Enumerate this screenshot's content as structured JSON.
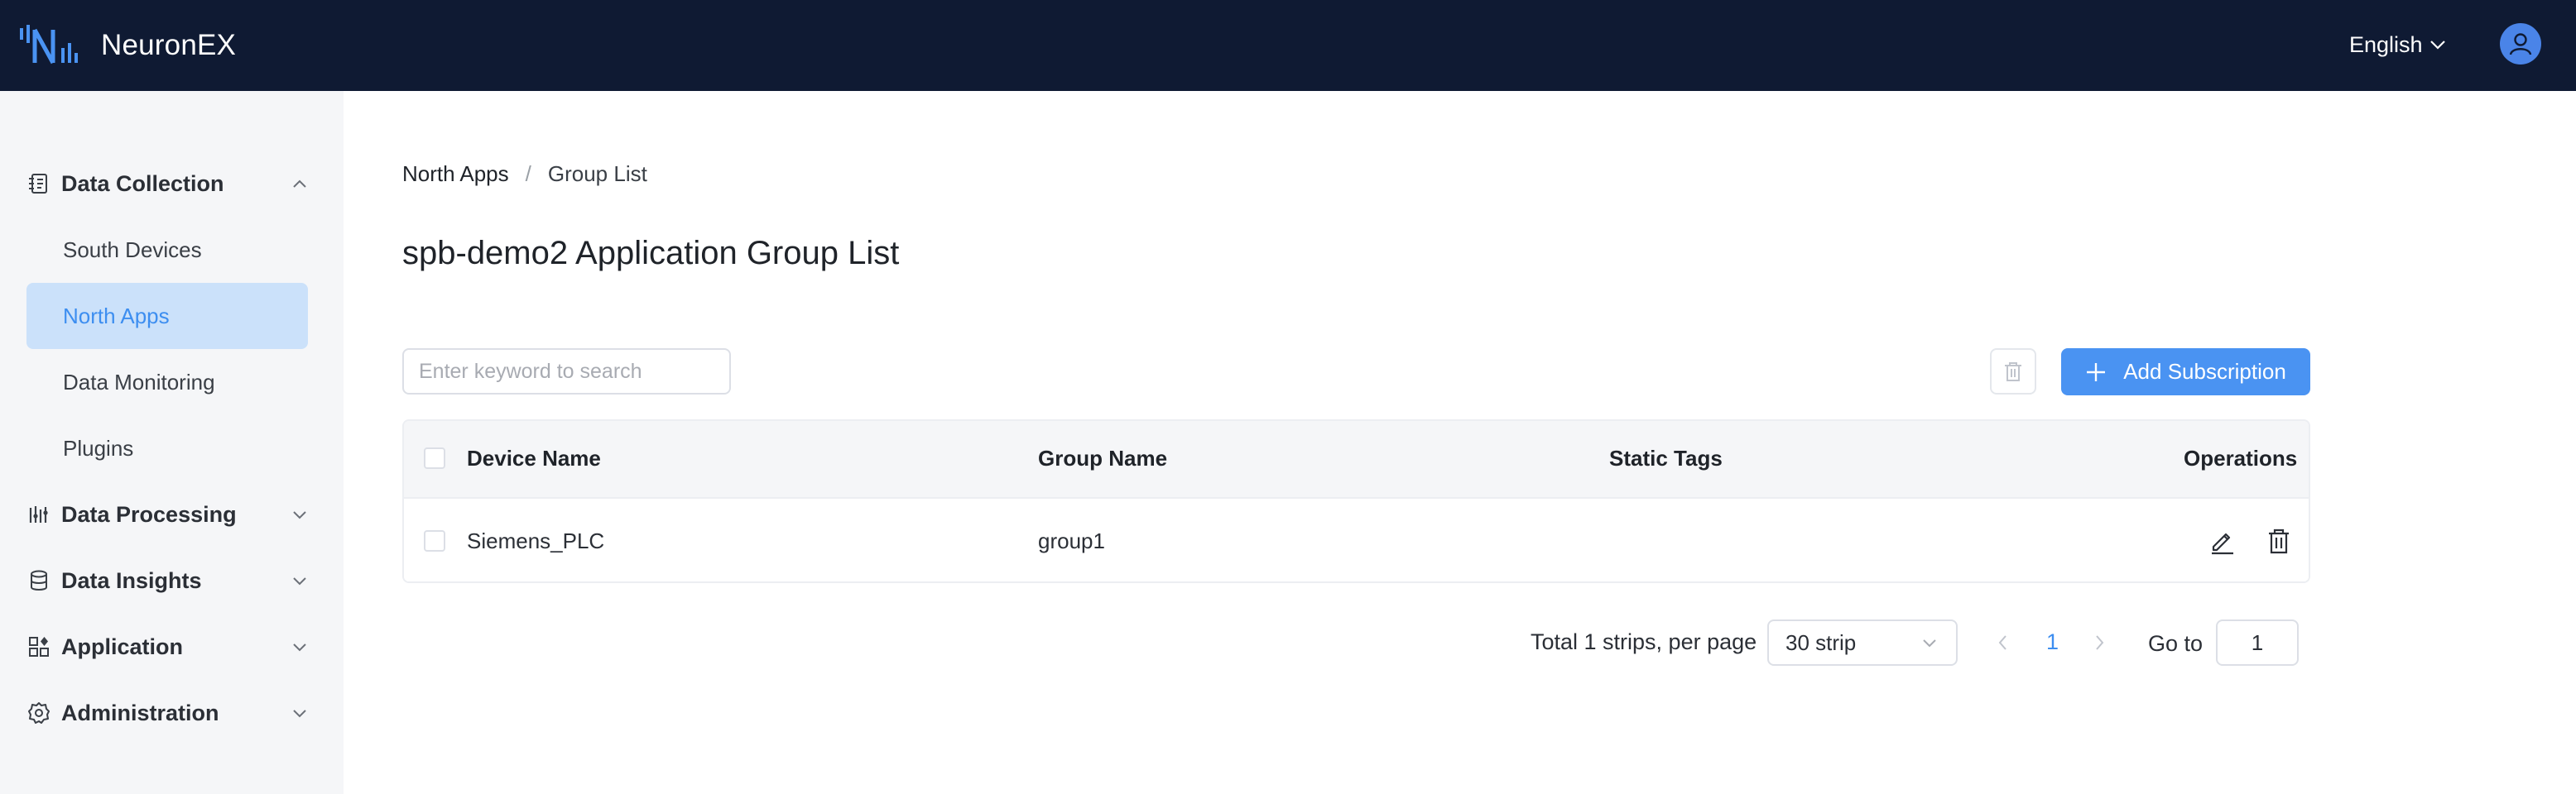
{
  "app": {
    "name": "NeuronEX"
  },
  "header": {
    "language": "English",
    "avatar_icon": "user-icon"
  },
  "sidebar": {
    "groups": [
      {
        "label": "Data Collection",
        "icon": "data-collection-icon",
        "expanded": true,
        "items": [
          {
            "label": "South Devices",
            "active": false
          },
          {
            "label": "North Apps",
            "active": true
          },
          {
            "label": "Data Monitoring",
            "active": false
          },
          {
            "label": "Plugins",
            "active": false
          }
        ]
      },
      {
        "label": "Data Processing",
        "icon": "data-processing-icon",
        "expanded": false
      },
      {
        "label": "Data Insights",
        "icon": "database-icon",
        "expanded": false
      },
      {
        "label": "Application",
        "icon": "application-icon",
        "expanded": false
      },
      {
        "label": "Administration",
        "icon": "gear-icon",
        "expanded": false
      }
    ]
  },
  "breadcrumb": {
    "parent": "North Apps",
    "separator": "/",
    "current": "Group List"
  },
  "page": {
    "title": "spb-demo2 Application Group List"
  },
  "toolbar": {
    "search_placeholder": "Enter keyword to search",
    "add_label": "Add Subscription"
  },
  "table": {
    "columns": [
      "Device Name",
      "Group Name",
      "Static Tags",
      "Operations"
    ],
    "rows": [
      {
        "device_name": "Siemens_PLC",
        "group_name": "group1",
        "static_tags": ""
      }
    ]
  },
  "pagination": {
    "total_text": "Total 1 strips, per page",
    "page_size": "30 strip",
    "current_page": "1",
    "goto_label": "Go to",
    "goto_value": "1"
  },
  "colors": {
    "header_bg": "#0f1a33",
    "sidebar_bg": "#f5f6f8",
    "accent": "#4a93f2",
    "active_item_bg": "#cbe1fa",
    "active_text": "#3d8ef0"
  }
}
